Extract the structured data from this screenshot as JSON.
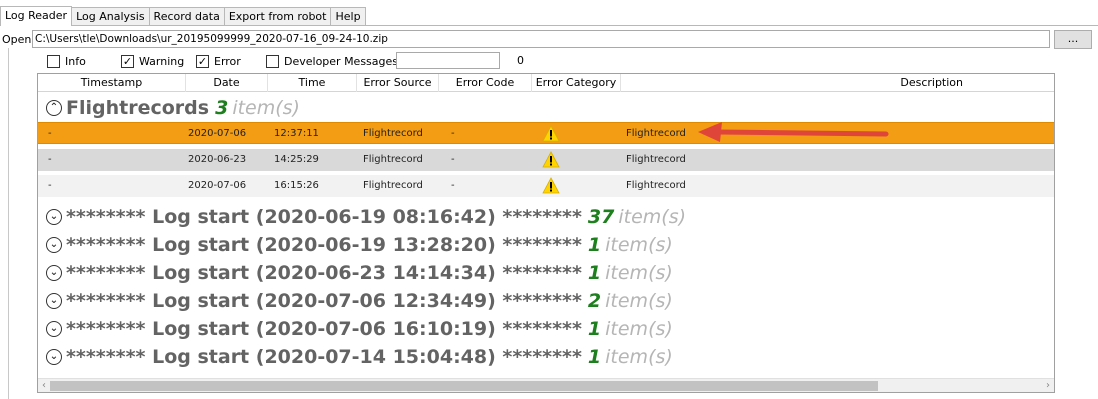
{
  "tabs": [
    {
      "label": "Log Reader",
      "active": true
    },
    {
      "label": "Log Analysis",
      "active": false
    },
    {
      "label": "Record data",
      "active": false
    },
    {
      "label": "Export from robot",
      "active": false
    },
    {
      "label": "Help",
      "active": false
    }
  ],
  "open": {
    "label": "Open",
    "path": "C:\\Users\\tle\\Downloads\\ur_20195099999_2020-07-16_09-24-10.zip",
    "browse_label": "..."
  },
  "filters": {
    "info": {
      "label": "Info",
      "checked": false
    },
    "warning": {
      "label": "Warning",
      "checked": true
    },
    "error": {
      "label": "Error",
      "checked": true
    },
    "developer": {
      "label": "Developer Messages",
      "checked": false
    },
    "search_value": "",
    "count": "0"
  },
  "columns": [
    "Timestamp",
    "Date",
    "Time",
    "Error Source",
    "Error Code",
    "Error Category",
    "Description"
  ],
  "flight_group": {
    "title": "Flightrecords",
    "count": "3",
    "items_label": "item(s)",
    "rows": [
      {
        "timestamp": "-",
        "date": "2020-07-06",
        "time": "12:37:11",
        "source": "Flightrecord",
        "code": "-",
        "category_icon": "warning-icon",
        "description": "Flightrecord"
      },
      {
        "timestamp": "-",
        "date": "2020-06-23",
        "time": "14:25:29",
        "source": "Flightrecord",
        "code": "-",
        "category_icon": "warning-icon",
        "description": "Flightrecord"
      },
      {
        "timestamp": "-",
        "date": "2020-07-06",
        "time": "16:15:26",
        "source": "Flightrecord",
        "code": "-",
        "category_icon": "warning-icon",
        "description": "Flightrecord"
      }
    ]
  },
  "log_groups": [
    {
      "title": "******** Log start (2020-06-19 08:16:42) ********",
      "count": "37",
      "items_label": "item(s)"
    },
    {
      "title": "******** Log start (2020-06-19 13:28:20) ********",
      "count": "1",
      "items_label": "item(s)"
    },
    {
      "title": "******** Log start (2020-06-23 14:14:34) ********",
      "count": "1",
      "items_label": "item(s)"
    },
    {
      "title": "******** Log start (2020-07-06 12:34:49) ********",
      "count": "2",
      "items_label": "item(s)"
    },
    {
      "title": "******** Log start (2020-07-06 16:10:19) ********",
      "count": "1",
      "items_label": "item(s)"
    },
    {
      "title": "******** Log start (2020-07-14 15:04:48) ********",
      "count": "1",
      "items_label": "item(s)"
    }
  ],
  "colors": {
    "selected_row": "#f29d13",
    "annotation_arrow": "#e0453a",
    "count_green": "#1e7f1e",
    "warning_yellow": "#ffd400"
  }
}
